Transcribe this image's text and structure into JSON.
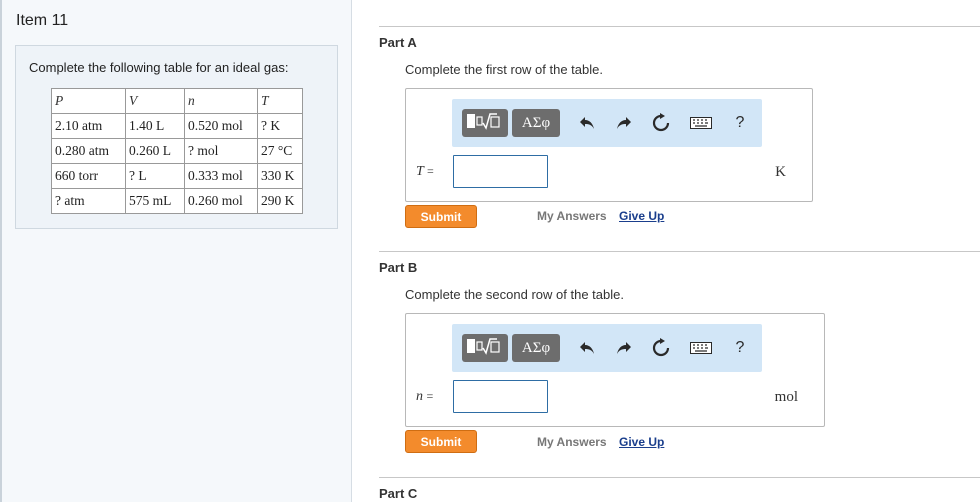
{
  "item": {
    "title": "Item 11"
  },
  "problem": {
    "text": "Complete the following table for an ideal gas:",
    "headers": [
      "P",
      "V",
      "n",
      "T"
    ],
    "rows": [
      [
        "2.10 atm",
        "1.40 L",
        "0.520 mol",
        "? K"
      ],
      [
        "0.280 atm",
        "0.260 L",
        "? mol",
        "27 °C"
      ],
      [
        "660 torr",
        "? L",
        "0.333 mol",
        "330 K"
      ],
      [
        "? atm",
        "575 mL",
        "0.260 mol",
        "290 K"
      ]
    ]
  },
  "toolbar": {
    "template_icon": "template-sqrt-icon",
    "greek_label": "ΑΣφ",
    "undo_icon": "undo-icon",
    "redo_icon": "redo-icon",
    "reset_icon": "reset-icon",
    "keyboard_icon": "keyboard-icon",
    "help_label": "?"
  },
  "parts": [
    {
      "label": "Part A",
      "instruction": "Complete the first row of the table.",
      "variable": "T",
      "equals": "=",
      "unit": "K",
      "input_value": "",
      "submit_label": "Submit",
      "my_answers_label": "My Answers",
      "give_up_label": "Give Up"
    },
    {
      "label": "Part B",
      "instruction": "Complete the second row of the table.",
      "variable": "n",
      "equals": "=",
      "unit": "mol",
      "input_value": "",
      "submit_label": "Submit",
      "my_answers_label": "My Answers",
      "give_up_label": "Give Up"
    },
    {
      "label": "Part C"
    }
  ]
}
